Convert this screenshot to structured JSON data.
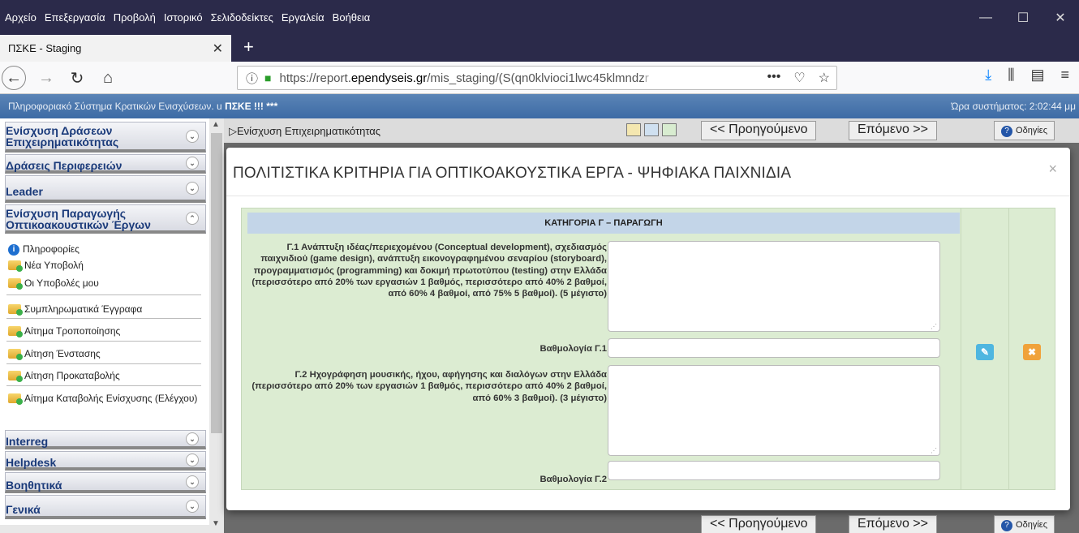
{
  "browser": {
    "menu": [
      "Αρχείο",
      "Επεξεργασία",
      "Προβολή",
      "Ιστορικό",
      "Σελιδοδείκτες",
      "Εργαλεία",
      "Βοήθεια"
    ],
    "tab_title": "ΠΣΚΕ - Staging",
    "url_prefix": "https://report.",
    "url_domain": "ependyseis.gr",
    "url_path": "/mis_staging/(S(qn0klvioci1lwc45klmndz",
    "url_fade": "r",
    "url_more": "•••"
  },
  "app": {
    "system_name": "Πληροφοριακό Σύστημα Κρατικών Ενισχύσεων. u",
    "system_code": "ΠΣΚΕ !!! ***",
    "clock": "Ώρα συστήματος: 2:02:44 μμ"
  },
  "sidebar": {
    "sections": [
      {
        "label": "Ενίσχυση Δράσεων Επιχειρηματικότητας"
      },
      {
        "label": "Δράσεις Περιφερειών"
      },
      {
        "label": "Leader"
      },
      {
        "label": "Ενίσχυση Παραγωγής Οπτικοακουστικών Έργων"
      },
      {
        "label": "Interreg"
      },
      {
        "label": "Helpdesk"
      },
      {
        "label": "Βοηθητικά"
      },
      {
        "label": "Γενικά"
      }
    ],
    "items": [
      {
        "label": "Πληροφορίες",
        "icon": "info-icon"
      },
      {
        "label": "Νέα Υποβολή",
        "icon": "folder-icon"
      },
      {
        "label": "Οι Υποβολές μου",
        "icon": "folder-icon"
      },
      {
        "label": "Συμπληρωματικά Έγγραφα",
        "icon": "folder-icon"
      },
      {
        "label": "Αίτημα Τροποποίησης",
        "icon": "folder-icon"
      },
      {
        "label": "Αίτηση Ένστασης",
        "icon": "folder-icon"
      },
      {
        "label": "Αίτηση Προκαταβολής",
        "icon": "folder-icon"
      },
      {
        "label": "Αίτημα Καταβολής Ενίσχυσης (Ελέγχου)",
        "icon": "folder-icon"
      }
    ]
  },
  "toolbar": {
    "breadcrumb": "Ενίσχυση Επιχειρηματικότητας",
    "prev": "<< Προηγούμενο",
    "next": "Επόμενο >>",
    "help": "Οδηγίες"
  },
  "modal": {
    "title": "ΠΟΛΙΤΙΣΤΙΚΑ ΚΡΙΤΗΡΙΑ ΓΙΑ ΟΠΤΙΚΟΑΚΟΥΣΤΙΚΑ ΕΡΓΑ - ΨΗΦΙΑΚΑ ΠΑΙΧΝΙΔΙΑ",
    "close": "×",
    "category": "ΚΑΤΗΓΟΡΙΑ Γ – ΠΑΡΑΓΩΓΗ",
    "q1": "Γ.1 Ανάπτυξη ιδέας/περιεχομένου (Conceptual development), σχεδιασμός παιχνιδιού (game design), ανάπτυξη εικονογραφημένου σεναρίου (storyboard), προγραμματισμός (programming) και δοκιμή πρωτοτύπου (testing) στην Ελλάδα (περισσότερο από 20% των εργασιών 1 βαθμός, περισσότερο από 40% 2 βαθμοί, από 60% 4 βαθμοί, από 75% 5 βαθμοί). (5 μέγιστο)",
    "q1_score_label": "Βαθμολογία Γ.1",
    "q2": "Γ.2 Ηχογράφηση μουσικής, ήχου, αφήγησης και διαλόγων στην Ελλάδα (περισσότερο από 20% των εργασιών 1 βαθμός, περισσότερο από 40% 2 βαθμοί, από 60% 3 βαθμοί). (3 μέγιστο)",
    "q2_score_label": "Βαθμολογία Γ.2"
  },
  "colors": {
    "app_bar": "#3d6ba5",
    "panel_bg": "#dcecd2",
    "panel_head": "#c3d5e8",
    "edit_btn": "#4fb6e0",
    "delete_btn": "#f0a23a"
  }
}
